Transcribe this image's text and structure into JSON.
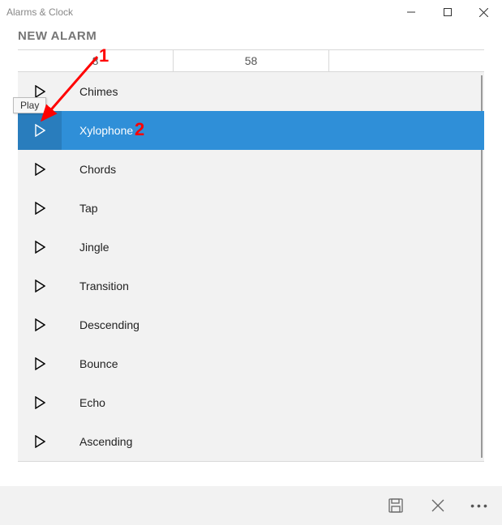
{
  "window": {
    "title": "Alarms & Clock"
  },
  "page": {
    "heading": "NEW ALARM"
  },
  "time": {
    "hour": "8",
    "minute": "58",
    "ampm": ""
  },
  "tooltip": {
    "text": "Play"
  },
  "sounds": {
    "selected_index": 1,
    "items": [
      {
        "label": "Chimes"
      },
      {
        "label": "Xylophone"
      },
      {
        "label": "Chords"
      },
      {
        "label": "Tap"
      },
      {
        "label": "Jingle"
      },
      {
        "label": "Transition"
      },
      {
        "label": "Descending"
      },
      {
        "label": "Bounce"
      },
      {
        "label": "Echo"
      },
      {
        "label": "Ascending"
      }
    ]
  },
  "annotations": {
    "num1": "1",
    "num2": "2"
  }
}
